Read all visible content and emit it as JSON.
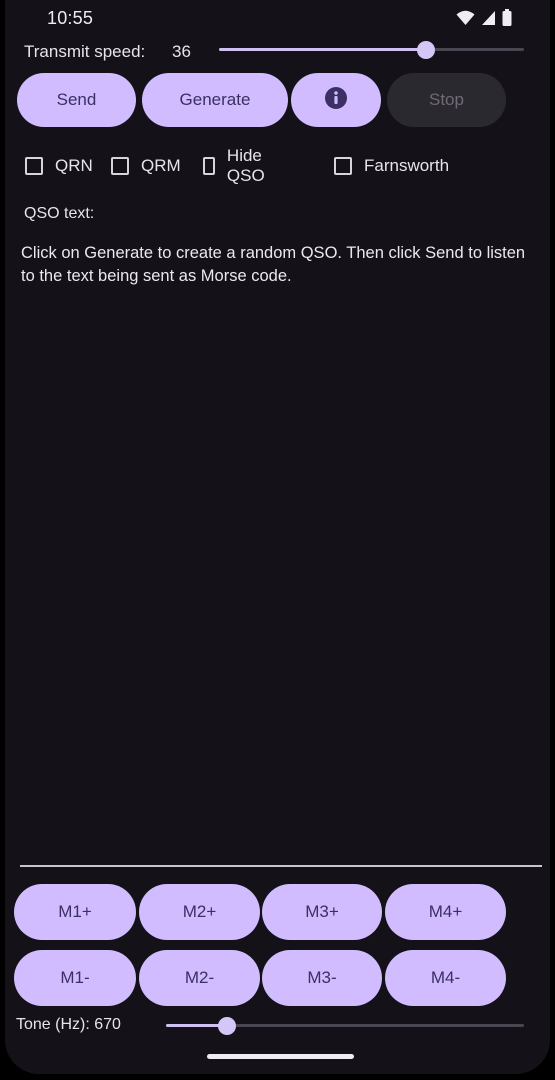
{
  "status_bar": {
    "time": "10:55",
    "icons": [
      "wifi-icon",
      "signal-icon",
      "battery-icon"
    ]
  },
  "speed": {
    "label": "Transmit speed:",
    "value": "36",
    "slider_level": 0.68
  },
  "buttons": {
    "send": "Send",
    "generate": "Generate",
    "info_icon": "info-icon",
    "stop": "Stop"
  },
  "checkboxes": [
    {
      "label": "QRN",
      "checked": false
    },
    {
      "label": "QRM",
      "checked": false
    },
    {
      "label": "Hide QSO",
      "checked": false
    },
    {
      "label": "Farnsworth",
      "checked": false
    }
  ],
  "qso": {
    "label": "QSO text:",
    "text": "Click on Generate to create a random QSO. Then click Send to listen to the text being sent as Morse code."
  },
  "memory_buttons": {
    "plus": [
      "M1+",
      "M2+",
      "M3+",
      "M4+"
    ],
    "minus": [
      "M1-",
      "M2-",
      "M3-",
      "M4-"
    ]
  },
  "tone": {
    "label": "Tone (Hz): 670",
    "slider_level": 0.17
  },
  "colors": {
    "background": "#141218",
    "button_primary": "#d0bcff",
    "button_text": "#3b2f63",
    "button_disabled": "#2b2930"
  }
}
